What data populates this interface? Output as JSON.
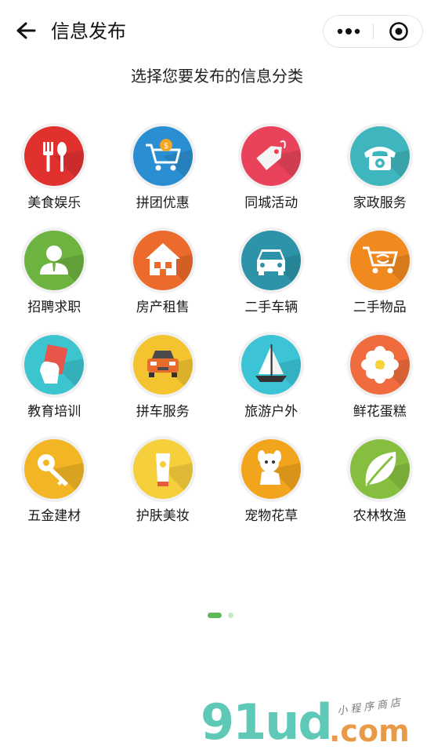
{
  "header": {
    "title": "信息发布",
    "back_icon": "arrow-left-icon",
    "more_icon": "more-dots-icon",
    "close_icon": "target-circle-icon"
  },
  "subtitle": "选择您要发布的信息分类",
  "categories": [
    {
      "label": "美食娱乐",
      "icon": "fork-spoon-icon",
      "color": "#e0312f"
    },
    {
      "label": "拼团优惠",
      "icon": "shopping-cart-icon",
      "color": "#2a8fd2"
    },
    {
      "label": "同城活动",
      "icon": "tag-icon",
      "color": "#e8435a"
    },
    {
      "label": "家政服务",
      "icon": "telephone-icon",
      "color": "#3fb6bd"
    },
    {
      "label": "招聘求职",
      "icon": "person-icon",
      "color": "#6db33f"
    },
    {
      "label": "房产租售",
      "icon": "house-icon",
      "color": "#ec6a2b"
    },
    {
      "label": "二手车辆",
      "icon": "car-icon",
      "color": "#2c93a9"
    },
    {
      "label": "二手物品",
      "icon": "recycle-cart-icon",
      "color": "#f08a1e"
    },
    {
      "label": "教育培训",
      "icon": "hand-card-icon",
      "color": "#3cc4cf"
    },
    {
      "label": "拼车服务",
      "icon": "car-front-icon",
      "color": "#f4c430"
    },
    {
      "label": "旅游户外",
      "icon": "sailboat-icon",
      "color": "#3cc4d6"
    },
    {
      "label": "鲜花蛋糕",
      "icon": "flower-icon",
      "color": "#f06b3d"
    },
    {
      "label": "五金建材",
      "icon": "key-icon",
      "color": "#f2b524"
    },
    {
      "label": "护肤美妆",
      "icon": "cream-tube-icon",
      "color": "#f6cf3c"
    },
    {
      "label": "宠物花草",
      "icon": "pet-dog-icon",
      "color": "#f2a41c"
    },
    {
      "label": "农林牧渔",
      "icon": "leaf-icon",
      "color": "#86bf3f"
    }
  ],
  "pager": {
    "active": 1,
    "total": 2
  },
  "watermark": {
    "main": "91ud",
    "suffix": ".com",
    "tagline": "小程序商店"
  }
}
